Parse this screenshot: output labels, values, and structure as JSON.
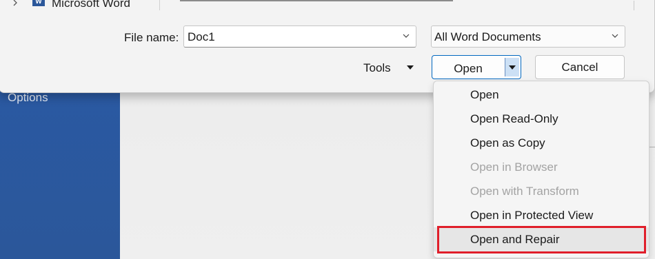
{
  "sidebar": {
    "options_label": "Options"
  },
  "dialog": {
    "tree_item_label": "Microsoft Word",
    "tree_item_icon": "word-icon",
    "file_name_label": "File name:",
    "file_name_value": "Doc1",
    "file_type_value": "All Word Documents",
    "tools_label": "Tools",
    "open_label": "Open",
    "cancel_label": "Cancel"
  },
  "open_menu": {
    "items": [
      {
        "label": "Open",
        "enabled": true
      },
      {
        "label": "Open Read-Only",
        "enabled": true
      },
      {
        "label": "Open as Copy",
        "enabled": true
      },
      {
        "label": "Open in Browser",
        "enabled": false
      },
      {
        "label": "Open with Transform",
        "enabled": false
      },
      {
        "label": "Open in Protected View",
        "enabled": true
      },
      {
        "label": "Open and Repair",
        "enabled": true,
        "highlighted": true
      }
    ]
  },
  "colors": {
    "accent": "#0067c0",
    "word_blue": "#2b579a",
    "highlight_border": "#e01e2a"
  }
}
